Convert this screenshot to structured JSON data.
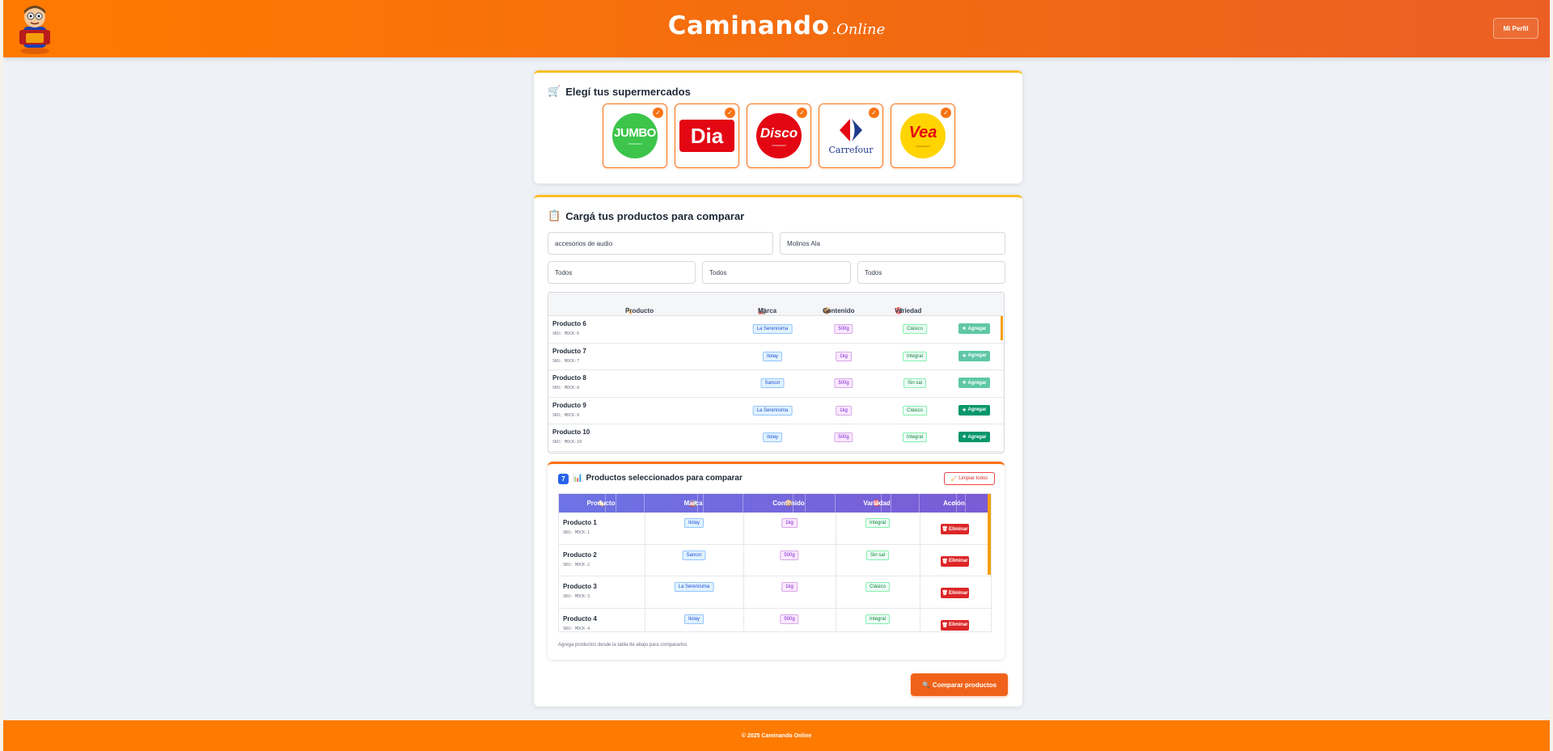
{
  "header": {
    "brand_main": "Caminando",
    "brand_sub": ".Online",
    "profile_label": "Mi Perfil",
    "mascot_icon": "mascot-logo"
  },
  "supermarkets": {
    "title": "Elegí tus supermercados",
    "icon": "cart-icon",
    "check_glyph": "✓",
    "items": [
      {
        "name": "JUMBO",
        "sub": "cencosud",
        "selected": true,
        "color": "#3cc54a"
      },
      {
        "name": "Dia",
        "sub": "",
        "selected": true,
        "color": "#e30613"
      },
      {
        "name": "Disco",
        "sub": "cencosud",
        "selected": true,
        "color": "#e30613"
      },
      {
        "name": "Carrefour",
        "sub": "",
        "selected": true,
        "color": "#1e3a8a"
      },
      {
        "name": "Vea",
        "sub": "cencosud",
        "selected": true,
        "color": "#ffd400"
      }
    ]
  },
  "products": {
    "title": "Cargá tus productos para comparar",
    "icon": "clipboard-icon",
    "search_value": "accesorios de audio",
    "brand_value": "Molinos Ala",
    "filter1": "Todos",
    "filter2": "Todos",
    "filter3": "Todos",
    "columns": {
      "product": "Producto",
      "brand": "Marca",
      "content": "Contenido",
      "variety": "Variedad"
    },
    "add_label": "Agregar",
    "rows": [
      {
        "name": "Producto 6",
        "sku": "SKU: MOCK-6",
        "brand": "La Serenísima",
        "content": "500g",
        "variety": "Clásico",
        "added": true
      },
      {
        "name": "Producto 7",
        "sku": "SKU: MOCK-7",
        "brand": "Ilolay",
        "content": "1kg",
        "variety": "Integral",
        "added": true
      },
      {
        "name": "Producto 8",
        "sku": "SKU: MOCK-8",
        "brand": "Sancor",
        "content": "500g",
        "variety": "Sin sal",
        "added": true
      },
      {
        "name": "Producto 9",
        "sku": "SKU: MOCK-9",
        "brand": "La Serenísima",
        "content": "1kg",
        "variety": "Clásico",
        "added": false
      },
      {
        "name": "Producto 10",
        "sku": "SKU: MOCK-10",
        "brand": "Ilolay",
        "content": "500g",
        "variety": "Integral",
        "added": false
      }
    ]
  },
  "selected": {
    "count": "7",
    "title": "Productos seleccionados para comparar",
    "clear_label": "Limpiar todos",
    "columns": {
      "product": "Producto",
      "brand": "Marca",
      "content": "Contenido",
      "variety": "Variedad",
      "action": "Acción"
    },
    "delete_label": "Eliminar",
    "rows": [
      {
        "name": "Producto 1",
        "sku": "SKU: MOCK-1",
        "brand": "Ilolay",
        "content": "1kg",
        "variety": "Integral"
      },
      {
        "name": "Producto 2",
        "sku": "SKU: MOCK-2",
        "brand": "Sancor",
        "content": "500g",
        "variety": "Sin sal"
      },
      {
        "name": "Producto 3",
        "sku": "SKU: MOCK-3",
        "brand": "La Serenísima",
        "content": "1kg",
        "variety": "Clásico"
      },
      {
        "name": "Producto 4",
        "sku": "SKU: MOCK-4",
        "brand": "Ilolay",
        "content": "500g",
        "variety": "Integral"
      }
    ],
    "hint": "Agrega productos desde la tabla de abajo para compararlos"
  },
  "compare_label": "Comparar productos",
  "footer": "© 2025 Caminando Online",
  "colors": {
    "brand_orange": "#ff7a00",
    "accent_yellow": "#fbbf24",
    "add_green": "#059669",
    "delete_red": "#dc2626",
    "selected_header": "#6d73e4"
  }
}
